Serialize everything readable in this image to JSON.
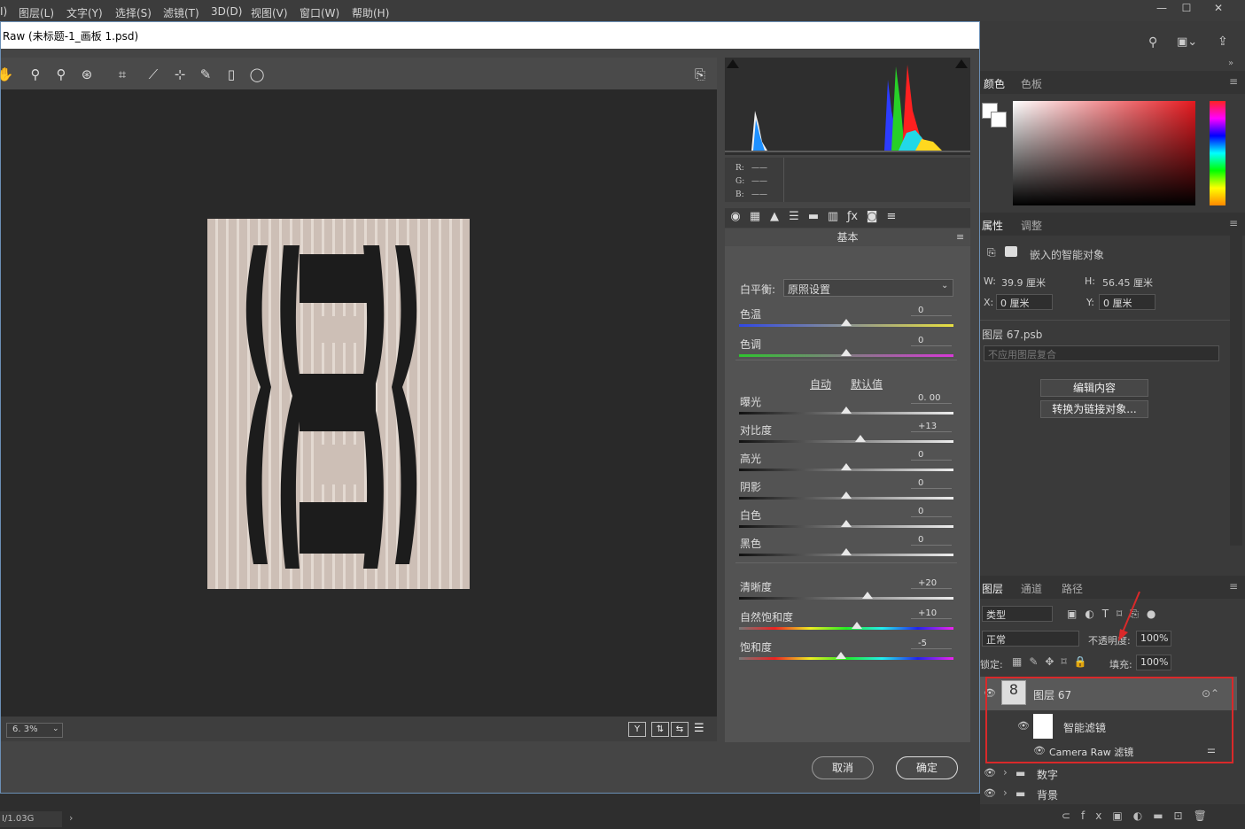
{
  "menubar": {
    "items": [
      "I)",
      "图层(L)",
      "文字(Y)",
      "选择(S)",
      "滤镜(T)",
      "3D(D)",
      "视图(V)",
      "窗口(W)",
      "帮助(H)"
    ],
    "window_buttons": [
      "—",
      "☐",
      "✕"
    ]
  },
  "dialog": {
    "title": "Raw (未标题-1_画板 1.psd)",
    "zoom": "6. 3%",
    "view_buttons": [
      "Y",
      "⇅",
      "⇆",
      "☰"
    ],
    "cancel_label": "取消",
    "ok_label": "确定",
    "rgb": {
      "r": "R:",
      "g": "G:",
      "b": "B:",
      "r_val": "——",
      "g_val": "——",
      "b_val": "——"
    },
    "panel_title": "基本",
    "white_balance": {
      "label": "白平衡:",
      "value": "原照设置"
    },
    "auto_label": "自动",
    "default_label": "默认值",
    "sliders": [
      {
        "label": "色温",
        "value": "0",
        "level": 0.5
      },
      {
        "label": "色调",
        "value": "0",
        "level": 0.5
      },
      {
        "label": "曝光",
        "value": "0. 00",
        "level": 0.5
      },
      {
        "label": "对比度",
        "value": "+13",
        "level": 0.565
      },
      {
        "label": "高光",
        "value": "0",
        "level": 0.5
      },
      {
        "label": "阴影",
        "value": "0",
        "level": 0.5
      },
      {
        "label": "白色",
        "value": "0",
        "level": 0.5
      },
      {
        "label": "黑色",
        "value": "0",
        "level": 0.5
      },
      {
        "label": "清晰度",
        "value": "+20",
        "level": 0.6
      },
      {
        "label": "自然饱和度",
        "value": "+10",
        "level": 0.55
      },
      {
        "label": "饱和度",
        "value": "-5",
        "level": 0.475
      }
    ]
  },
  "status": {
    "doc_size": "I/1.03G"
  },
  "color_panel": {
    "tab_color": "颜色",
    "tab_swatches": "色板"
  },
  "properties_panel": {
    "tab_props": "属性",
    "tab_adjust": "调整",
    "type_label": "嵌入的智能对象",
    "w_label": "W:",
    "w_value": "39.9 厘米",
    "h_label": "H:",
    "h_value": "56.45 厘米",
    "x_label": "X:",
    "x_value": "0 厘米",
    "y_label": "Y:",
    "y_value": "0 厘米",
    "file_name": "图层 67.psb",
    "comp_placeholder": "不应用图层复合",
    "edit_btn": "编辑内容",
    "convert_btn": "转换为链接对象..."
  },
  "layers_panel": {
    "tab_layers": "图层",
    "tab_channels": "通道",
    "tab_paths": "路径",
    "filter_label": "类型",
    "blend_mode": "正常",
    "opacity_label": "不透明度:",
    "opacity_value": "100%",
    "lock_label": "锁定:",
    "fill_label": "填充:",
    "fill_value": "100%",
    "layers": [
      {
        "name": "图层 67"
      },
      {
        "name": "智能滤镜"
      },
      {
        "name": "Camera Raw 滤镜"
      },
      {
        "name": "数字"
      },
      {
        "name": "背景"
      }
    ]
  },
  "colors": {
    "accent_red": "#d9292a",
    "dialog_border": "#6b8fb5"
  }
}
